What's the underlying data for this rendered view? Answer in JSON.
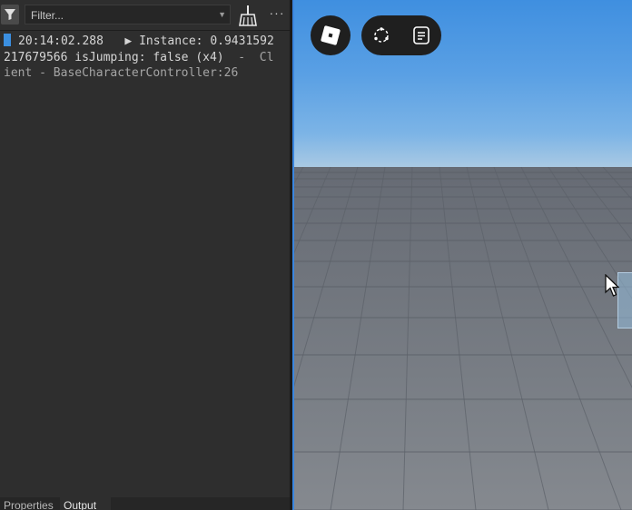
{
  "output_panel": {
    "toolbar": {
      "filter_toggle_icon": "funnel-icon",
      "filter_placeholder": "Filter...",
      "filter_dropdown_icon": "chevron-down-icon",
      "clear_icon": "broom-icon",
      "more_label": "···"
    },
    "log": {
      "marker_color": "#3b8fe0",
      "entries": [
        {
          "timestamp": "20:14:02.288",
          "expand_icon": "▶",
          "message": "Instance: 0.9431592217679566 isJumping: false (x4)",
          "source": "-  Client - BaseCharacterController:26"
        }
      ]
    },
    "tabs": [
      {
        "label": "Properties"
      },
      {
        "label": "Output"
      }
    ]
  },
  "viewport": {
    "accent_color": "#3a86e0",
    "buttons": {
      "menu_icon": "roblox-logo-icon",
      "selfview_icon": "selfview-icon",
      "chat_icon": "chat-icon"
    }
  }
}
